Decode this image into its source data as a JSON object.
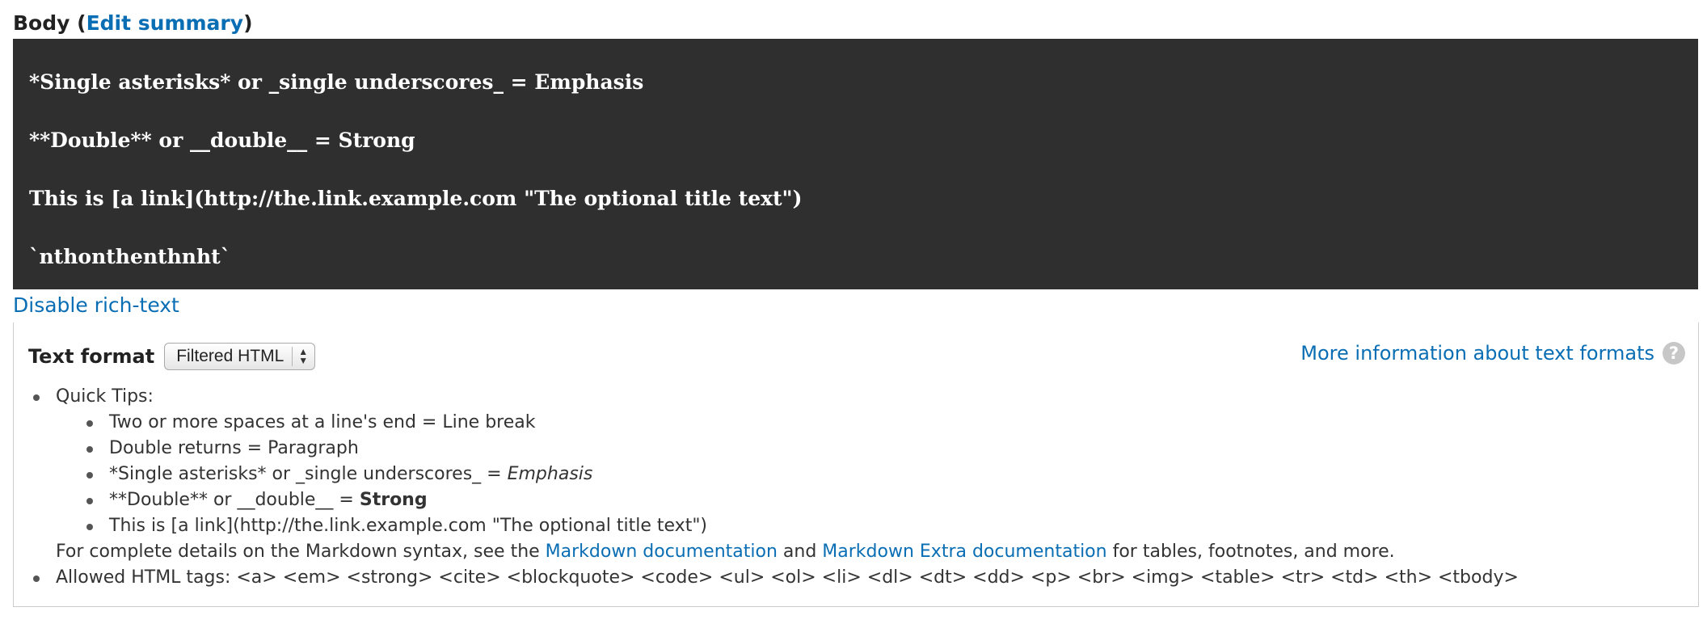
{
  "field": {
    "label": "Body",
    "open_paren": " (",
    "edit_summary": "Edit summary",
    "close_paren": ")"
  },
  "editor": {
    "lines": [
      "*Single asterisks* or _single underscores_ = Emphasis",
      "**Double** or __double__ = Strong",
      "This is [a link](http://the.link.example.com \"The optional title text\")",
      "`nthonthenthnht`"
    ]
  },
  "disable_rich_text": "Disable rich-text",
  "text_format": {
    "label": "Text format",
    "selected": "Filtered HTML",
    "more_info": "More information about text formats",
    "help_icon": "question-circle-icon",
    "help_glyph": "?"
  },
  "tips": {
    "quick_tips_label": "Quick Tips:",
    "tip1": "Two or more spaces at a line's end = Line break",
    "tip2": "Double returns = Paragraph",
    "tip3_prefix": "*Single asterisks* or _single underscores_ = ",
    "tip3_em": "Emphasis",
    "tip4_prefix": "**Double** or __double__ = ",
    "tip4_strong": "Strong",
    "tip5": "This is [a link](http://the.link.example.com \"The optional title text\")",
    "details_prefix": "For complete details on the Markdown syntax, see the ",
    "markdown_doc_link": "Markdown documentation",
    "details_and": " and ",
    "markdown_extra_link": "Markdown Extra documentation",
    "details_suffix": " for tables, footnotes, and more.",
    "allowed_tags": "Allowed HTML tags: <a> <em> <strong> <cite> <blockquote> <code> <ul> <ol> <li> <dl> <dt> <dd> <p> <br> <img> <table> <tr> <td> <th> <tbody>"
  },
  "colors": {
    "link": "#0a6eb4",
    "editor_bg": "#2f2f2f",
    "editor_text": "#ffffff"
  }
}
